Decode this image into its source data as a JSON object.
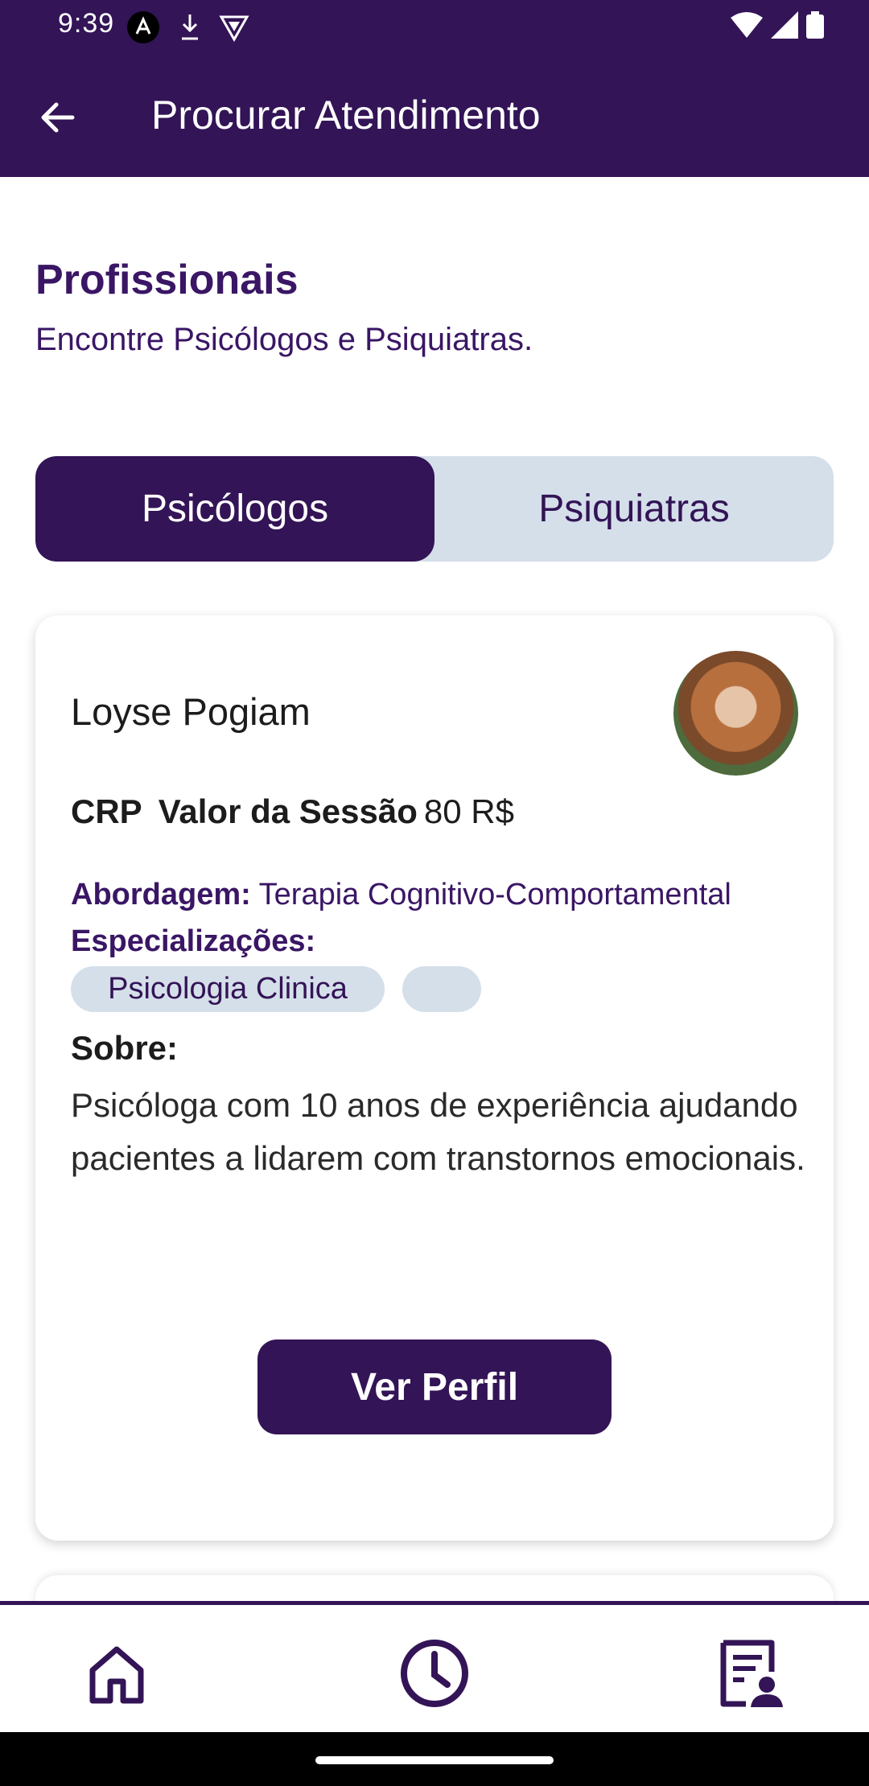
{
  "status_bar": {
    "time": "9:39",
    "left_icons": [
      "android-icon",
      "download-icon",
      "shield-icon"
    ],
    "right_icons": [
      "wifi-icon",
      "signal-icon",
      "battery-icon"
    ]
  },
  "app_bar": {
    "title": "Procurar Atendimento",
    "back_icon": "arrow-left-icon"
  },
  "section": {
    "title": "Profissionais",
    "subtitle": "Encontre Psicólogos e Psiquiatras."
  },
  "tabs": [
    {
      "label": "Psicólogos",
      "active": true
    },
    {
      "label": "Psiquiatras",
      "active": false
    }
  ],
  "card": {
    "name": "Loyse Pogiam",
    "crp_label": "CRP",
    "price_label": "Valor da Sessão",
    "price_value": "80 R$",
    "approach_label": "Abordagem:",
    "approach_value": "Terapia Cognitivo-Comportamental",
    "specializations_label": "Especializações:",
    "specializations": [
      "Psicologia Clinica",
      ""
    ],
    "about_label": "Sobre:",
    "about_text": "Psicóloga com 10 anos de experiência ajudando pacientes a lidarem com transtornos emocionais.",
    "button_label": "Ver Perfil"
  },
  "bottom_nav": [
    {
      "icon": "home-icon"
    },
    {
      "icon": "clock-icon"
    },
    {
      "icon": "profile-document-icon"
    }
  ],
  "colors": {
    "primary": "#331456",
    "chip_bg": "#d5dfea",
    "text_purple": "#3a1665"
  }
}
